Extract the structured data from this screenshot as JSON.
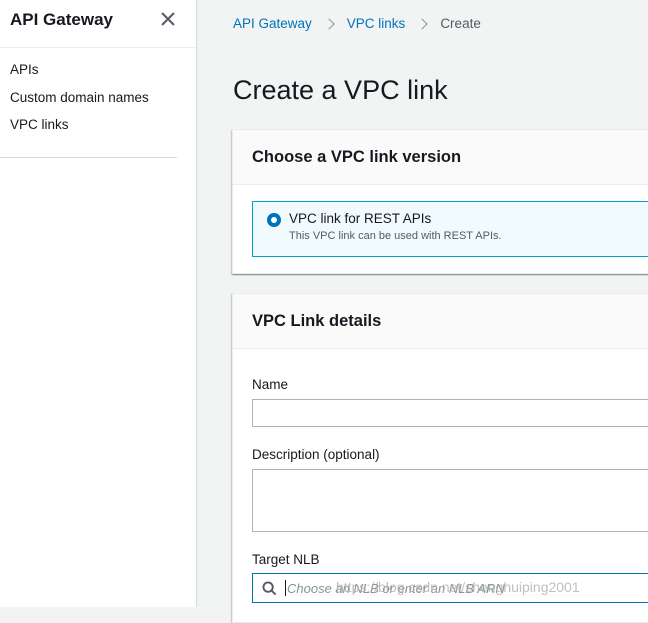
{
  "sidebar": {
    "title": "API Gateway",
    "close_icon": "close-icon",
    "items": [
      {
        "label": "APIs"
      },
      {
        "label": "Custom domain names"
      },
      {
        "label": "VPC links"
      }
    ]
  },
  "breadcrumb": {
    "items": [
      {
        "label": "API Gateway"
      },
      {
        "label": "VPC links"
      }
    ],
    "current": "Create",
    "separator_icon": "chevron-right-icon"
  },
  "page": {
    "title": "Create a VPC link"
  },
  "version_panel": {
    "title": "Choose a VPC link version",
    "option": {
      "label": "VPC link for REST APIs",
      "description": "This VPC link can be used with REST APIs.",
      "selected": true
    }
  },
  "details_panel": {
    "title": "VPC Link details",
    "name_label": "Name",
    "name_value": "",
    "description_label": "Description (optional)",
    "description_value": "",
    "target_label": "Target NLB",
    "target_placeholder": "Choose an NLB or enter an NLB ARN"
  },
  "watermark": "https://blog.csdn.net/shenghuiping2001",
  "colors": {
    "link": "#0073bb",
    "selected_border": "#00a1c9",
    "selected_bg": "#f1faff",
    "page_bg": "#f2f3f3"
  }
}
